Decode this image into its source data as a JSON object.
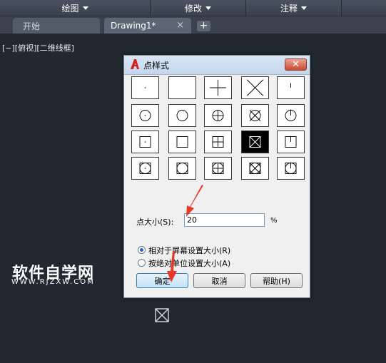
{
  "menubar": {
    "items": [
      {
        "label": "绘图"
      },
      {
        "label": "修改"
      },
      {
        "label": "注释"
      }
    ]
  },
  "tabs": {
    "start_label": "开始",
    "active_label": "Drawing1*",
    "close_glyph": "×",
    "add_glyph": "+"
  },
  "viewport": {
    "label": "[−][俯视][二维线框]"
  },
  "dialog": {
    "title": "点样式",
    "close_glyph": "✕",
    "point_styles": [
      "dot",
      "blank",
      "plus",
      "x",
      "tick",
      "circle-dot",
      "circle",
      "circle-plus",
      "circle-x",
      "circle-tick",
      "square-dot",
      "square",
      "square-plus",
      "square-x",
      "square-tick",
      "sqcircle-dot",
      "sqcircle",
      "sqcircle-plus",
      "sqcircle-x",
      "sqcircle-tick"
    ],
    "selected_style_index": 13,
    "point_size_label": "点大小(S):",
    "point_size_value": "20",
    "point_size_unit": "%",
    "radio_relative_label": "相对于屏幕设置大小(R)",
    "radio_absolute_label": "按绝对单位设置大小(A)",
    "radio_selected": "relative",
    "ok_label": "确定",
    "cancel_label": "取消",
    "help_label": "帮助(H)"
  },
  "watermark": {
    "title": "软件自学网",
    "url": "WWW.RJZXW.COM"
  },
  "colors": {
    "canvas_bg": "#212830",
    "annotation_arrow": "#e8382c"
  }
}
